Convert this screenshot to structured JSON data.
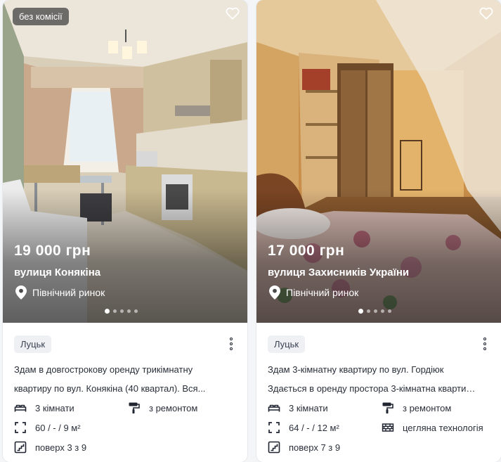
{
  "listings": [
    {
      "badge": "без комісії",
      "price": "19 000 грн",
      "street": "вулиця Конякіна",
      "market": "Північний ринок",
      "city": "Луцьк",
      "desc_line1": "Здам в довгострокову оренду трикімнатну",
      "desc_line2": "квартиру по вул. Конякіна (40 квартал). Вся...",
      "rooms": "3 кімнати",
      "repair": "з ремонтом",
      "area": "60 / - / 9 м²",
      "floor": "поверх 3 з 9",
      "photo_count": 5,
      "active_photo": 1
    },
    {
      "price": "17 000 грн",
      "street": "вулиця Захисників України",
      "market": "Північний ринок",
      "city": "Луцьк",
      "desc_line1": "Здам 3-кімнатну квартиру по вул. Гордіюк",
      "desc_line2": "Здається в оренду простора 3-кімнатна квартир...",
      "rooms": "3 кімнати",
      "repair": "з ремонтом",
      "area": "64 / - / 12 м²",
      "tech": "цегляна технологія",
      "floor": "поверх 7 з 9",
      "photo_count": 5,
      "active_photo": 1
    }
  ],
  "icons": {
    "favorite": "heart-outline-icon",
    "location": "map-pin-icon",
    "rooms": "bed-icon",
    "repair": "paint-roller-icon",
    "area": "area-frame-icon",
    "floor": "stairs-icon",
    "tech": "brick-wall-icon",
    "menu": "kebab-menu-icon"
  }
}
